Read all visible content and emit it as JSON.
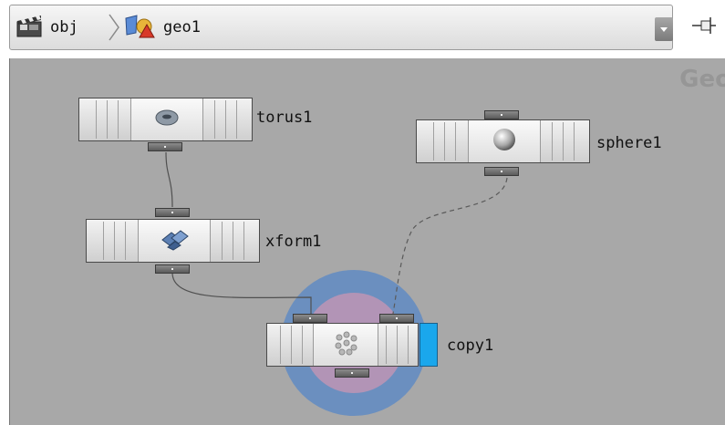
{
  "breadcrumb": {
    "items": [
      {
        "label": "obj",
        "icon": "clapperboard-icon"
      },
      {
        "label": "geo1",
        "icon": "geometry-shapes-icon"
      }
    ]
  },
  "network": {
    "context_label": "Geo",
    "nodes": [
      {
        "name": "torus1",
        "icon": "torus-icon"
      },
      {
        "name": "sphere1",
        "icon": "sphere-icon"
      },
      {
        "name": "xform1",
        "icon": "transform-icon"
      },
      {
        "name": "copy1",
        "icon": "copy-icon",
        "display_flag": true,
        "selected": true
      }
    ]
  },
  "colors": {
    "network_bg": "#a8a8a8",
    "selection_outer": "#6b8fbf",
    "selection_inner": "#b294b6",
    "display_flag": "#1aa7ec"
  }
}
